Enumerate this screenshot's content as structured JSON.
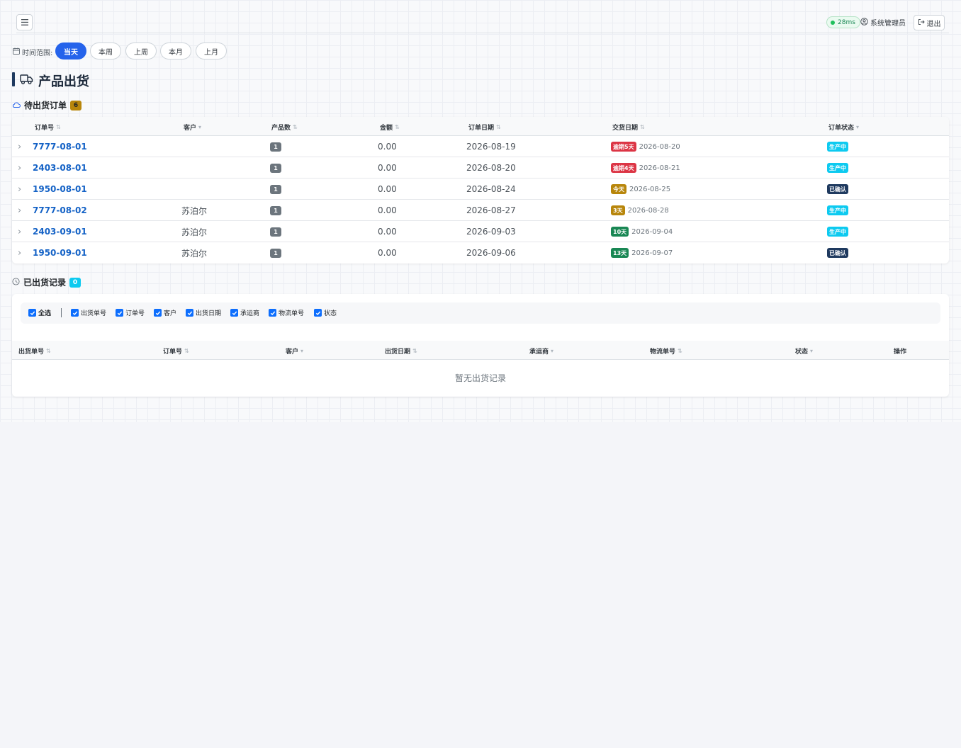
{
  "header": {
    "ping": "28ms",
    "user": "系统管理员",
    "logout": "退出"
  },
  "time_range": {
    "label": "时间范围:",
    "options": [
      "当天",
      "本周",
      "上周",
      "本月",
      "上月"
    ],
    "selected": "当天"
  },
  "page_title": "产品出货",
  "pending": {
    "title": "待出货订单",
    "count": "6",
    "columns": [
      "订单号",
      "客户",
      "产品数",
      "金额",
      "订单日期",
      "交货日期",
      "订单状态"
    ],
    "rows": [
      {
        "order_no": "7777-08-01",
        "customer": "",
        "qty": "1",
        "amount": "0.00",
        "order_date": "2026-08-19",
        "due_tag": "逾期5天",
        "due_color": "#dc3545",
        "due_date": "2026-08-20",
        "status": "生产中",
        "status_color": "#0dcaf0"
      },
      {
        "order_no": "2403-08-01",
        "customer": "",
        "qty": "1",
        "amount": "0.00",
        "order_date": "2026-08-20",
        "due_tag": "逾期4天",
        "due_color": "#dc3545",
        "due_date": "2026-08-21",
        "status": "生产中",
        "status_color": "#0dcaf0"
      },
      {
        "order_no": "1950-08-01",
        "customer": "",
        "qty": "1",
        "amount": "0.00",
        "order_date": "2026-08-24",
        "due_tag": "今天",
        "due_color": "#b8860b",
        "due_date": "2026-08-25",
        "status": "已确认",
        "status_color": "#1f3a5f"
      },
      {
        "order_no": "7777-08-02",
        "customer": "苏泊尔",
        "qty": "1",
        "amount": "0.00",
        "order_date": "2026-08-27",
        "due_tag": "3天",
        "due_color": "#b8860b",
        "due_date": "2026-08-28",
        "status": "生产中",
        "status_color": "#0dcaf0"
      },
      {
        "order_no": "2403-09-01",
        "customer": "苏泊尔",
        "qty": "1",
        "amount": "0.00",
        "order_date": "2026-09-03",
        "due_tag": "10天",
        "due_color": "#198754",
        "due_date": "2026-09-04",
        "status": "生产中",
        "status_color": "#0dcaf0"
      },
      {
        "order_no": "1950-09-01",
        "customer": "苏泊尔",
        "qty": "1",
        "amount": "0.00",
        "order_date": "2026-09-06",
        "due_tag": "13天",
        "due_color": "#198754",
        "due_date": "2026-09-07",
        "status": "已确认",
        "status_color": "#1f3a5f"
      }
    ]
  },
  "shipped": {
    "title": "已出货记录",
    "count": "0",
    "filters": [
      "全选",
      "出货单号",
      "订单号",
      "客户",
      "出货日期",
      "承运商",
      "物流单号",
      "状态"
    ],
    "columns": [
      "出货单号",
      "订单号",
      "客户",
      "出货日期",
      "承运商",
      "物流单号",
      "状态",
      "操作"
    ],
    "empty_text": "暂无出货记录"
  },
  "colors": {
    "accent": "#2563eb",
    "link": "#1462c6",
    "overdue": "#dc3545",
    "warning": "#b8860b",
    "ok": "#198754",
    "in_production": "#0dcaf0",
    "confirmed": "#1f3a5f"
  }
}
